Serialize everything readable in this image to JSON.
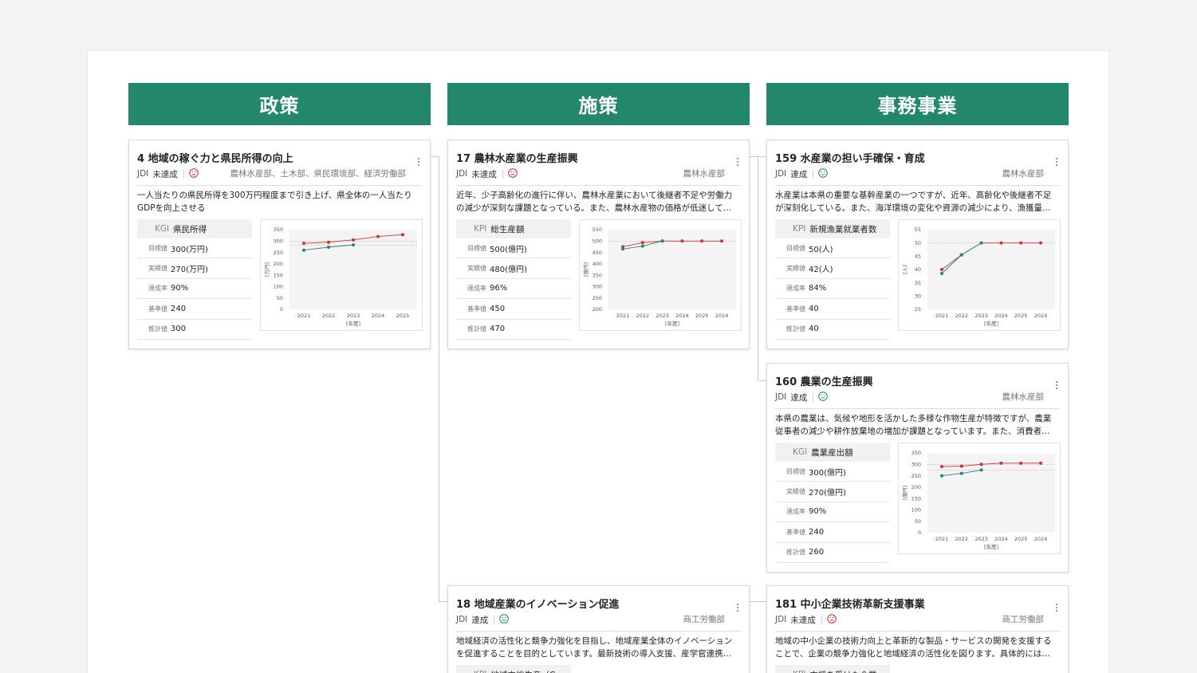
{
  "columns": [
    "政策",
    "施策",
    "事務事業"
  ],
  "cards": {
    "policy4": {
      "title": "4 地域の稼ぐ力と県民所得の向上",
      "jdi": "JDI",
      "status": "未達成",
      "achieved": false,
      "dept": "農林水産部、土木部、県民環境部、経済労働部",
      "desc": "一人当たりの県民所得を300万円程度まで引き上げ、県全体の一人当たりGDPを向上させる",
      "kpi_type": "KGI",
      "kpi_name": "県民所得",
      "rows": [
        {
          "k": "目標値",
          "v": "300(万円)"
        },
        {
          "k": "実績値",
          "v": "270(万円)"
        },
        {
          "k": "達成率",
          "v": "90%"
        },
        {
          "k": "基準値",
          "v": "240"
        },
        {
          "k": "推計値",
          "v": "300"
        }
      ]
    },
    "measure17": {
      "title": "17 農林水産業の生産振興",
      "jdi": "JDI",
      "status": "未達成",
      "achieved": false,
      "dept": "農林水産部",
      "desc": "近年、少子高齢化の進行に伴い、農林水産業において後継者不足や労働力の減少が深刻な課題となっている。また、農林水産物の価格が低迷して…",
      "kpi_type": "KPI",
      "kpi_name": "総生産額",
      "rows": [
        {
          "k": "目標値",
          "v": "500(億円)"
        },
        {
          "k": "実績値",
          "v": "480(億円)"
        },
        {
          "k": "達成率",
          "v": "96%"
        },
        {
          "k": "基準値",
          "v": "450"
        },
        {
          "k": "推計値",
          "v": "470"
        }
      ]
    },
    "project159": {
      "title": "159 水産業の担い手確保・育成",
      "jdi": "JDI",
      "status": "達成",
      "achieved": true,
      "dept": "農林水産部",
      "desc": "水産業は本県の重要な基幹産業の一つですが、近年、高齢化や後継者不足が深刻化している。また、海洋環境の変化や資源の減少により、漁獲量…",
      "kpi_type": "KPI",
      "kpi_name": "新規漁業就業者数",
      "rows": [
        {
          "k": "目標値",
          "v": "50(人)"
        },
        {
          "k": "実績値",
          "v": "42(人)"
        },
        {
          "k": "達成率",
          "v": "84%"
        },
        {
          "k": "基準値",
          "v": "40"
        },
        {
          "k": "推計値",
          "v": "40"
        }
      ]
    },
    "project160": {
      "title": "160 農業の生産振興",
      "jdi": "JDI",
      "status": "達成",
      "achieved": true,
      "dept": "農林水産部",
      "desc": "本県の農業は、気候や地形を活かした多様な作物生産が特徴ですが、農業従事者の減少や耕作放棄地の増加が課題となっています。また、消費者…",
      "kpi_type": "KGI",
      "kpi_name": "農業産出額",
      "rows": [
        {
          "k": "目標値",
          "v": "300(億円)"
        },
        {
          "k": "実績値",
          "v": "270(億円)"
        },
        {
          "k": "達成率",
          "v": "90%"
        },
        {
          "k": "基準値",
          "v": "240"
        },
        {
          "k": "推計値",
          "v": "260"
        }
      ]
    },
    "measure18": {
      "title": "18 地域産業のイノベーション促進",
      "jdi": "JDI",
      "status": "達成",
      "achieved": true,
      "dept": "商工労働部",
      "desc": "地域経済の活性化と競争力強化を目指し、地域産業全体のイノベーションを促進することを目的としています。最新技術の導入支援、産学官連携…",
      "kpi_type": "KPI",
      "kpi_name": "地域内総生産（G",
      "rows": []
    },
    "project181": {
      "title": "181 中小企業技術革新支援事業",
      "jdi": "JDI",
      "status": "未達成",
      "achieved": false,
      "dept": "商工労働部",
      "desc": "地域の中小企業の技術力向上と革新的な製品・サービスの開発を支援することで、企業の競争力強化と地域経済の活性化を図ります。具体的には…",
      "kpi_type": "KPI",
      "kpi_name": "支援を受けた企業",
      "rows": []
    }
  },
  "chart_data": [
    {
      "id": "policy4",
      "type": "line",
      "x": [
        2021,
        2022,
        2023,
        2024,
        2025
      ],
      "ylim": [
        0,
        350
      ],
      "yticks": [
        0,
        50,
        100,
        150,
        200,
        250,
        300,
        350
      ],
      "ylabel": "[万円]",
      "xlabel": "[年度]",
      "series": [
        {
          "values": [
            290,
            295,
            305,
            320,
            328
          ],
          "color": "#d0312d"
        },
        {
          "values": [
            260,
            273,
            283,
            null,
            null
          ],
          "color": "#23876a"
        }
      ],
      "ref_lines": [
        300,
        283
      ]
    },
    {
      "id": "measure17",
      "type": "line",
      "x": [
        2021,
        2022,
        2023,
        2024,
        2025,
        2024
      ],
      "ylim": [
        200,
        550
      ],
      "yticks": [
        200,
        250,
        300,
        350,
        400,
        450,
        500,
        550
      ],
      "ylabel": "[億円]",
      "xlabel": "[年度]",
      "series": [
        {
          "values": [
            475,
            493,
            500,
            500,
            500,
            500
          ],
          "color": "#d0312d"
        },
        {
          "values": [
            465,
            478,
            500,
            null,
            null,
            null
          ],
          "color": "#23876a"
        }
      ],
      "ref_lines": [
        500
      ]
    },
    {
      "id": "project159",
      "type": "line",
      "x": [
        2021,
        2022,
        2023,
        2024,
        2025,
        2024
      ],
      "ylim": [
        25,
        55
      ],
      "yticks": [
        25,
        30,
        35,
        40,
        45,
        50,
        55
      ],
      "ylabel": "[人]",
      "xlabel": "[年度]",
      "series": [
        {
          "values": [
            40,
            45.5,
            50,
            50,
            50,
            50
          ],
          "color": "#d0312d"
        },
        {
          "values": [
            38.5,
            45.5,
            50,
            null,
            null,
            null
          ],
          "color": "#23876a"
        }
      ],
      "ref_lines": [
        50
      ]
    },
    {
      "id": "project160",
      "type": "line",
      "x": [
        2021,
        2022,
        2023,
        2024,
        2025,
        2024
      ],
      "ylim": [
        0,
        350
      ],
      "yticks": [
        0,
        50,
        100,
        150,
        200,
        250,
        300,
        350
      ],
      "ylabel": "[億円]",
      "xlabel": "[年度]",
      "series": [
        {
          "values": [
            290,
            292,
            300,
            305,
            305,
            305
          ],
          "color": "#d0312d"
        },
        {
          "values": [
            250,
            260,
            275,
            null,
            null,
            null
          ],
          "color": "#23876a"
        }
      ],
      "ref_lines": [
        300,
        275
      ]
    }
  ]
}
